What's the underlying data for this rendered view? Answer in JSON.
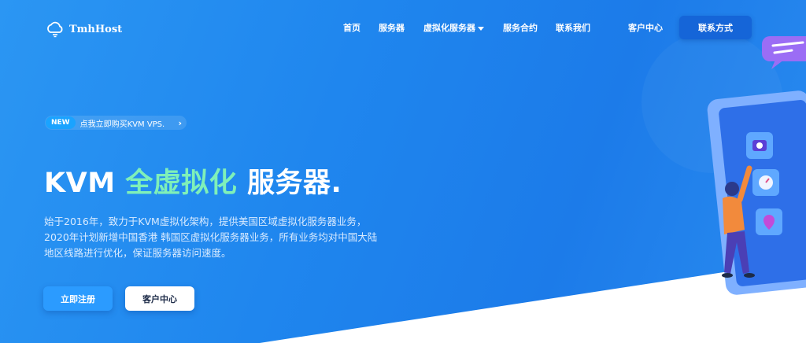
{
  "brand": {
    "name": "TmhHost",
    "logo_icon": "cloud-icon"
  },
  "nav": {
    "items": [
      {
        "label": "首页"
      },
      {
        "label": "服务器"
      },
      {
        "label": "虚拟化服务器",
        "has_dropdown": true
      },
      {
        "label": "服务合约"
      },
      {
        "label": "联系我们"
      },
      {
        "label": "客户中心"
      }
    ],
    "contact_button": "联系方式"
  },
  "announcement": {
    "badge": "NEW",
    "text": "点我立即购买KVM VPS.",
    "arrow": "›"
  },
  "hero": {
    "title_part1": "KVM",
    "title_accent": "全虚拟化",
    "title_part2": "服务器.",
    "description_lines": [
      "始于2016年，致力于KVM虚拟化架构，提供美国区域虚拟化服务器业务，",
      "2020年计划新增中国香港 韩国区虚拟化服务器业务，所有业务均对中国大陆",
      "地区线路进行优化，保证服务器访问速度。"
    ],
    "primary_button": "立即注册",
    "secondary_button": "客户中心"
  },
  "colors": {
    "background": "#1f86ee",
    "accent_text": "#7ff0b8",
    "primary_button": "#2b9bff",
    "contact_button": "#1565d8",
    "bubble": "#9b6df5"
  }
}
